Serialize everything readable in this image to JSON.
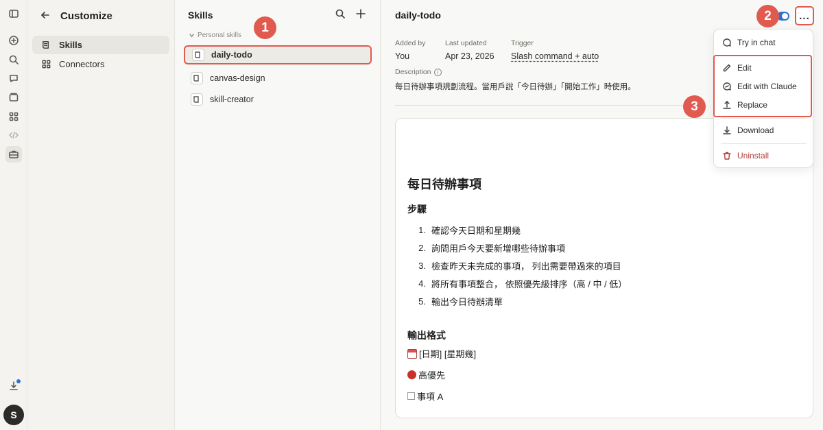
{
  "rail": {
    "items": [
      "sidebar-toggle",
      "new",
      "search",
      "chats",
      "projects",
      "artifacts",
      "code",
      "customize"
    ],
    "avatar_initial": "S"
  },
  "customize": {
    "title": "Customize",
    "nav": [
      {
        "label": "Skills",
        "active": true
      },
      {
        "label": "Connectors",
        "active": false
      }
    ]
  },
  "skills": {
    "title": "Skills",
    "group_label": "Personal skills",
    "items": [
      {
        "label": "daily-todo",
        "selected": true
      },
      {
        "label": "canvas-design",
        "selected": false
      },
      {
        "label": "skill-creator",
        "selected": false
      }
    ]
  },
  "detail": {
    "title": "daily-todo",
    "meta": {
      "added_by_label": "Added by",
      "added_by_value": "You",
      "last_updated_label": "Last updated",
      "last_updated_value": "Apr 23, 2026",
      "trigger_label": "Trigger",
      "trigger_value": "Slash command + auto"
    },
    "description_label": "Description",
    "description_text": "每日待辦事項規劃流程。當用戶說「今日待辦」「開始工作」時使用。",
    "toggle_on": true,
    "more_label": "...",
    "doc": {
      "h1": "每日待辦事項",
      "steps_heading": "步驟",
      "steps": [
        {
          "num": "1.",
          "text": "確認今天日期和星期幾"
        },
        {
          "num": "2.",
          "text": "詢問用戶今天要新增哪些待辦事項"
        },
        {
          "num": "3.",
          "text": "檢查昨天未完成的事項， 列出需要帶過來的項目"
        },
        {
          "num": "4.",
          "text": "將所有事項整合， 依照優先級排序（高 / 中 / 低）"
        },
        {
          "num": "5.",
          "text": "輸出今日待辦清單"
        }
      ],
      "format_heading": "輸出格式",
      "format_line1": "[日期] [星期幾]",
      "format_line2": "高優先",
      "format_line3": "事項 A"
    }
  },
  "menu": {
    "items": [
      {
        "label": "Try in chat",
        "icon": "chat-bubble-icon"
      },
      {
        "label": "Edit",
        "icon": "pencil-icon"
      },
      {
        "label": "Edit with Claude",
        "icon": "chat-edit-icon"
      },
      {
        "label": "Replace",
        "icon": "upload-icon"
      },
      {
        "label": "Download",
        "icon": "download-icon"
      },
      {
        "label": "Uninstall",
        "icon": "trash-icon"
      }
    ]
  },
  "badges": [
    "1",
    "2",
    "3"
  ],
  "colors": {
    "accent_red": "#e05a4f",
    "toggle_blue": "#2e6fd8",
    "danger": "#b0413a"
  }
}
